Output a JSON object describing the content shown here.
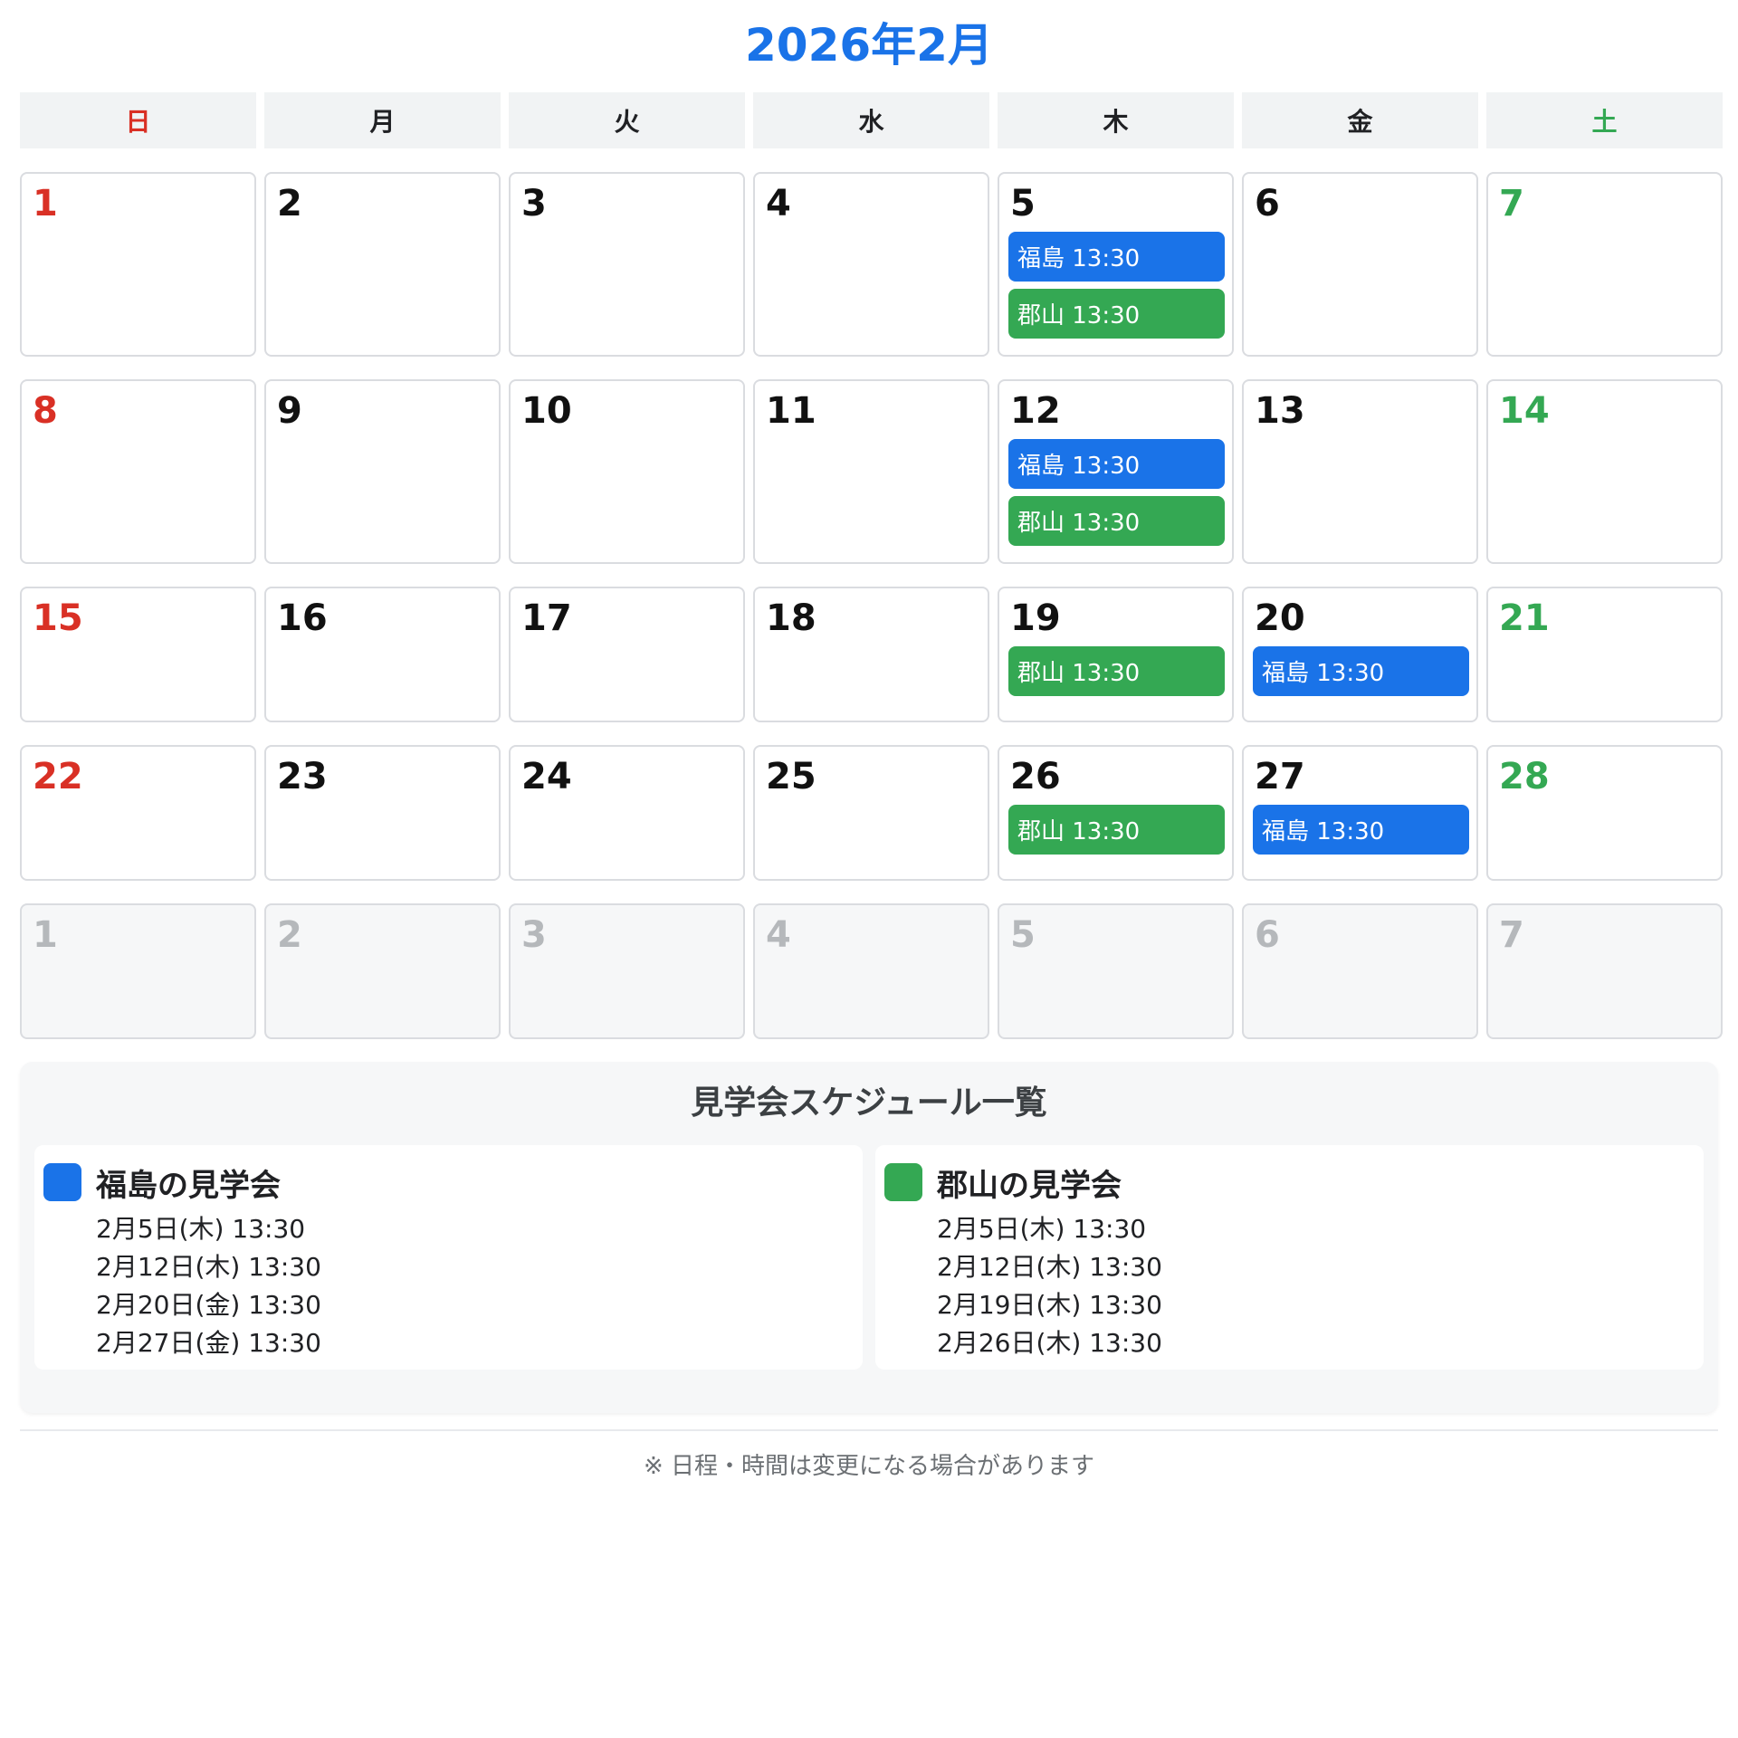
{
  "title": "2026年2月",
  "weekdays": [
    "日",
    "月",
    "火",
    "水",
    "木",
    "金",
    "土"
  ],
  "weeks": [
    {
      "days": [
        {
          "num": "1",
          "events": []
        },
        {
          "num": "2",
          "events": []
        },
        {
          "num": "3",
          "events": []
        },
        {
          "num": "4",
          "events": []
        },
        {
          "num": "5",
          "events": [
            {
              "label": "福島 13:30",
              "location": "fukushima"
            },
            {
              "label": "郡山 13:30",
              "location": "koriyama"
            }
          ]
        },
        {
          "num": "6",
          "events": []
        },
        {
          "num": "7",
          "events": []
        }
      ]
    },
    {
      "days": [
        {
          "num": "8",
          "events": []
        },
        {
          "num": "9",
          "events": []
        },
        {
          "num": "10",
          "events": []
        },
        {
          "num": "11",
          "events": []
        },
        {
          "num": "12",
          "events": [
            {
              "label": "福島 13:30",
              "location": "fukushima"
            },
            {
              "label": "郡山 13:30",
              "location": "koriyama"
            }
          ]
        },
        {
          "num": "13",
          "events": []
        },
        {
          "num": "14",
          "events": []
        }
      ]
    },
    {
      "days": [
        {
          "num": "15",
          "events": []
        },
        {
          "num": "16",
          "events": []
        },
        {
          "num": "17",
          "events": []
        },
        {
          "num": "18",
          "events": []
        },
        {
          "num": "19",
          "events": [
            {
              "label": "郡山 13:30",
              "location": "koriyama"
            }
          ]
        },
        {
          "num": "20",
          "events": [
            {
              "label": "福島 13:30",
              "location": "fukushima"
            }
          ]
        },
        {
          "num": "21",
          "events": []
        }
      ]
    },
    {
      "days": [
        {
          "num": "22",
          "events": []
        },
        {
          "num": "23",
          "events": []
        },
        {
          "num": "24",
          "events": []
        },
        {
          "num": "25",
          "events": []
        },
        {
          "num": "26",
          "events": [
            {
              "label": "郡山 13:30",
              "location": "koriyama"
            }
          ]
        },
        {
          "num": "27",
          "events": [
            {
              "label": "福島 13:30",
              "location": "fukushima"
            }
          ]
        },
        {
          "num": "28",
          "events": []
        }
      ]
    },
    {
      "outside": true,
      "days": [
        {
          "num": "1",
          "events": []
        },
        {
          "num": "2",
          "events": []
        },
        {
          "num": "3",
          "events": []
        },
        {
          "num": "4",
          "events": []
        },
        {
          "num": "5",
          "events": []
        },
        {
          "num": "6",
          "events": []
        },
        {
          "num": "7",
          "events": []
        }
      ]
    }
  ],
  "summary": {
    "title": "見学会スケジュール一覧",
    "fukushima": {
      "title": "福島の見学会",
      "items": [
        "2月5日(木) 13:30",
        "2月12日(木) 13:30",
        "2月20日(金) 13:30",
        "2月27日(金) 13:30"
      ]
    },
    "koriyama": {
      "title": "郡山の見学会",
      "items": [
        "2月5日(木) 13:30",
        "2月12日(木) 13:30",
        "2月19日(木) 13:30",
        "2月26日(木) 13:30"
      ]
    }
  },
  "note": "※ 日程・時間は変更になる場合があります",
  "colors": {
    "fukushima": "#1a73e8",
    "koriyama": "#34a853",
    "sunday": "#d93025",
    "saturday": "#34a853",
    "title": "#1a73e8"
  }
}
